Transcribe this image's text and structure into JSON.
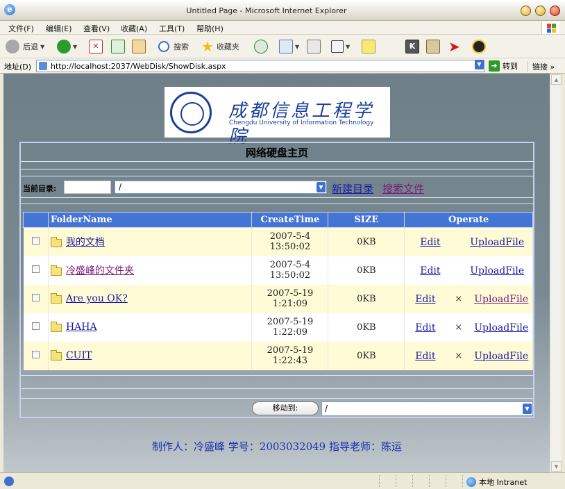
{
  "window": {
    "title": "Untitled Page - Microsoft Internet Explorer"
  },
  "menu": [
    "文件(F)",
    "编辑(E)",
    "查看(V)",
    "收藏(A)",
    "工具(T)",
    "帮助(H)"
  ],
  "toolbar": {
    "back_label": "后退",
    "search_label": "搜索",
    "favorites_label": "收藏夹"
  },
  "address": {
    "label": "地址(D)",
    "url": "http://localhost:2037/WebDisk/ShowDisk.aspx",
    "go_label": "转到",
    "links_label": "链接 »"
  },
  "logo": {
    "cn_name": "成都信息工程学院",
    "en_name": "Chengdu University of Information Technology"
  },
  "page": {
    "title": "网络硬盘主页",
    "current_dir_label": "当前目录:",
    "current_dir_value": "/",
    "new_folder_link": "新建目录",
    "search_file_link": "搜索文件"
  },
  "table": {
    "headers": [
      "FolderName",
      "CreateTime",
      "SIZE",
      "Operate"
    ],
    "rows": [
      {
        "name": "我的文档",
        "date": "2007-5-4",
        "time": "13:50:02",
        "size": "0KB",
        "edit": "Edit",
        "delete": "",
        "upload": "UploadFile"
      },
      {
        "name": "冷盛峰的文件夹",
        "date": "2007-5-4",
        "time": "13:50:02",
        "size": "0KB",
        "edit": "Edit",
        "delete": "",
        "upload": "UploadFile"
      },
      {
        "name": "Are you OK?",
        "date": "2007-5-19",
        "time": "1:21:09",
        "size": "0KB",
        "edit": "Edit",
        "delete": "×",
        "upload": "UploadFile"
      },
      {
        "name": "HAHA",
        "date": "2007-5-19",
        "time": "1:22:09",
        "size": "0KB",
        "edit": "Edit",
        "delete": "×",
        "upload": "UploadFile"
      },
      {
        "name": "CUIT",
        "date": "2007-5-19",
        "time": "1:22:43",
        "size": "0KB",
        "edit": "Edit",
        "delete": "×",
        "upload": "UploadFile"
      }
    ]
  },
  "move": {
    "button_label": "移动到:",
    "target_value": "/"
  },
  "footer": {
    "text": "制作人：冷盛峰  学号：2003032049 指导老师：陈运"
  },
  "status": {
    "zone_label": "本地 Intranet"
  },
  "colors": {
    "page_bg": "#7a8a93",
    "table_header": "#4474d4",
    "row_alt": "#fffbd6",
    "footer_text": "#1a2fb0"
  }
}
